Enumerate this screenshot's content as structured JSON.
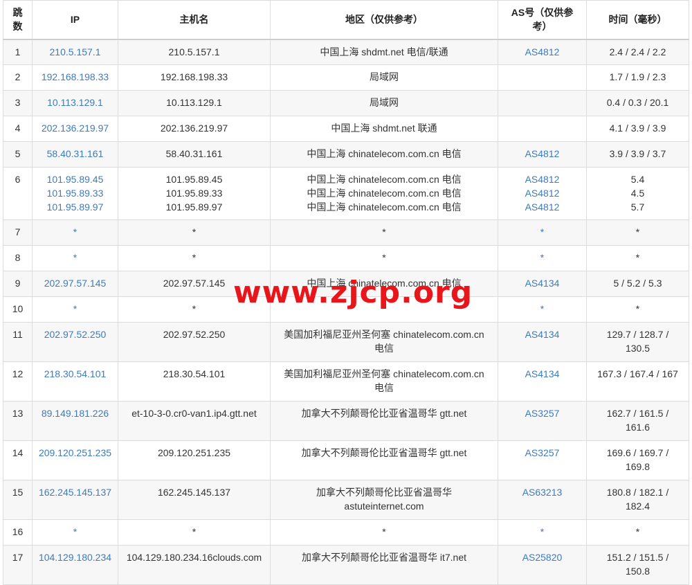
{
  "table": {
    "headers": {
      "hop": "跳数",
      "ip": "IP",
      "host": "主机名",
      "region": "地区（仅供参考）",
      "as": "AS号（仅供参考）",
      "time": "时间（毫秒）"
    },
    "rows": [
      {
        "hop": "1",
        "ips": [
          "210.5.157.1"
        ],
        "hosts": [
          "210.5.157.1"
        ],
        "regions": [
          "中国上海 shdmt.net 电信/联通"
        ],
        "as": [
          "AS4812"
        ],
        "times": [
          "2.4 / 2.4 / 2.2"
        ]
      },
      {
        "hop": "2",
        "ips": [
          "192.168.198.33"
        ],
        "hosts": [
          "192.168.198.33"
        ],
        "regions": [
          "局域网"
        ],
        "as": [
          ""
        ],
        "times": [
          "1.7 / 1.9 / 2.3"
        ]
      },
      {
        "hop": "3",
        "ips": [
          "10.113.129.1"
        ],
        "hosts": [
          "10.113.129.1"
        ],
        "regions": [
          "局域网"
        ],
        "as": [
          ""
        ],
        "times": [
          "0.4 / 0.3 / 20.1"
        ]
      },
      {
        "hop": "4",
        "ips": [
          "202.136.219.97"
        ],
        "hosts": [
          "202.136.219.97"
        ],
        "regions": [
          "中国上海 shdmt.net 联通"
        ],
        "as": [
          ""
        ],
        "times": [
          "4.1 / 3.9 / 3.9"
        ]
      },
      {
        "hop": "5",
        "ips": [
          "58.40.31.161"
        ],
        "hosts": [
          "58.40.31.161"
        ],
        "regions": [
          "中国上海 chinatelecom.com.cn 电信"
        ],
        "as": [
          "AS4812"
        ],
        "times": [
          "3.9 / 3.9 / 3.7"
        ]
      },
      {
        "hop": "6",
        "ips": [
          "101.95.89.45",
          "101.95.89.33",
          "101.95.89.97"
        ],
        "hosts": [
          "101.95.89.45",
          "101.95.89.33",
          "101.95.89.97"
        ],
        "regions": [
          "中国上海 chinatelecom.com.cn 电信",
          "中国上海 chinatelecom.com.cn 电信",
          "中国上海 chinatelecom.com.cn 电信"
        ],
        "as": [
          "AS4812",
          "AS4812",
          "AS4812"
        ],
        "times": [
          "5.4",
          "4.5",
          "5.7"
        ]
      },
      {
        "hop": "7",
        "ips": [
          "*"
        ],
        "hosts": [
          "*"
        ],
        "regions": [
          "*"
        ],
        "as": [
          "*"
        ],
        "times": [
          "*"
        ]
      },
      {
        "hop": "8",
        "ips": [
          "*"
        ],
        "hosts": [
          "*"
        ],
        "regions": [
          "*"
        ],
        "as": [
          "*"
        ],
        "times": [
          "*"
        ]
      },
      {
        "hop": "9",
        "ips": [
          "202.97.57.145"
        ],
        "hosts": [
          "202.97.57.145"
        ],
        "regions": [
          "中国上海 chinatelecom.com.cn 电信"
        ],
        "as": [
          "AS4134"
        ],
        "times": [
          "5 / 5.2 / 5.3"
        ]
      },
      {
        "hop": "10",
        "ips": [
          "*"
        ],
        "hosts": [
          "*"
        ],
        "regions": [
          "*"
        ],
        "as": [
          "*"
        ],
        "times": [
          "*"
        ]
      },
      {
        "hop": "11",
        "ips": [
          "202.97.52.250"
        ],
        "hosts": [
          "202.97.52.250"
        ],
        "regions": [
          "美国加利福尼亚州圣何塞 chinatelecom.com.cn 电信"
        ],
        "as": [
          "AS4134"
        ],
        "times": [
          "129.7 / 128.7 / 130.5"
        ]
      },
      {
        "hop": "12",
        "ips": [
          "218.30.54.101"
        ],
        "hosts": [
          "218.30.54.101"
        ],
        "regions": [
          "美国加利福尼亚州圣何塞 chinatelecom.com.cn 电信"
        ],
        "as": [
          "AS4134"
        ],
        "times": [
          "167.3 / 167.4 / 167"
        ]
      },
      {
        "hop": "13",
        "ips": [
          "89.149.181.226"
        ],
        "hosts": [
          "et-10-3-0.cr0-van1.ip4.gtt.net"
        ],
        "regions": [
          "加拿大不列颠哥伦比亚省温哥华 gtt.net"
        ],
        "as": [
          "AS3257"
        ],
        "times": [
          "162.7 / 161.5 / 161.6"
        ]
      },
      {
        "hop": "14",
        "ips": [
          "209.120.251.235"
        ],
        "hosts": [
          "209.120.251.235"
        ],
        "regions": [
          "加拿大不列颠哥伦比亚省温哥华 gtt.net"
        ],
        "as": [
          "AS3257"
        ],
        "times": [
          "169.6 / 169.7 / 169.8"
        ]
      },
      {
        "hop": "15",
        "ips": [
          "162.245.145.137"
        ],
        "hosts": [
          "162.245.145.137"
        ],
        "regions": [
          "加拿大不列颠哥伦比亚省温哥华 astuteinternet.com"
        ],
        "as": [
          "AS63213"
        ],
        "times": [
          "180.8 / 182.1 / 182.4"
        ]
      },
      {
        "hop": "16",
        "ips": [
          "*"
        ],
        "hosts": [
          "*"
        ],
        "regions": [
          "*"
        ],
        "as": [
          "*"
        ],
        "times": [
          "*"
        ]
      },
      {
        "hop": "17",
        "ips": [
          "104.129.180.234"
        ],
        "hosts": [
          "104.129.180.234.16clouds.com"
        ],
        "regions": [
          "加拿大不列颠哥伦比亚省温哥华 it7.net"
        ],
        "as": [
          "AS25820"
        ],
        "times": [
          "151.2 / 151.5 / 150.8"
        ]
      }
    ]
  },
  "watermark": "www.zjcp.org",
  "colors": {
    "link": "#3b7bbf",
    "watermark": "#e8161b",
    "stripe": "#f7f7f7",
    "border": "#dcdcdc"
  }
}
